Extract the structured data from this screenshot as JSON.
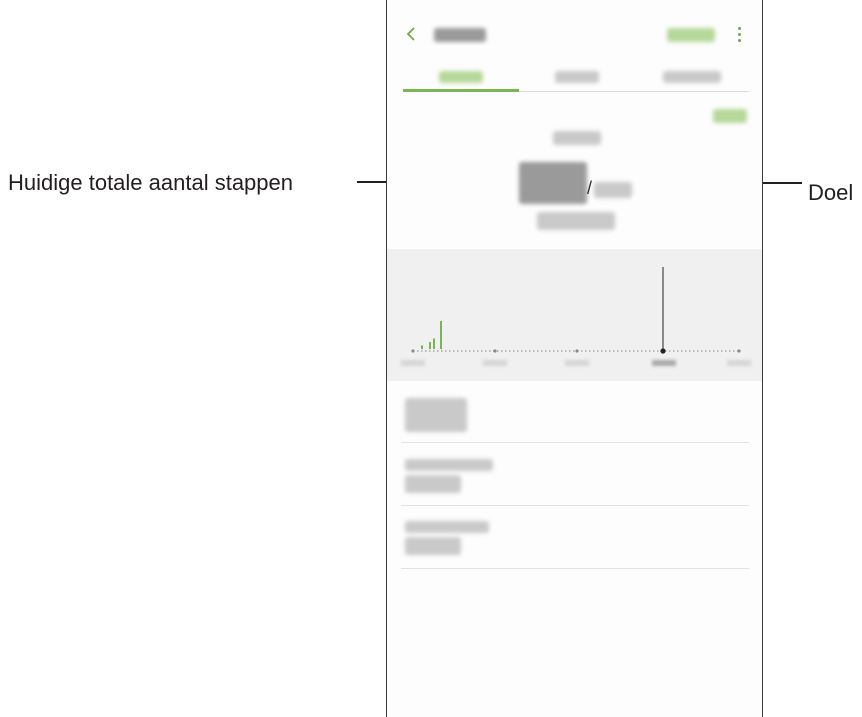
{
  "annotations": {
    "current_steps": "Huidige totale aantal stappen",
    "goal": "Doel"
  },
  "screen": {
    "goal_separator": "/",
    "colors": {
      "accent": "#79b653",
      "chart_background": "#f0f0f0",
      "bar_color": "#79b653",
      "marker_color": "#222222"
    },
    "icons": {
      "back": "chevron-left-icon",
      "more": "more-vertical-icon"
    },
    "tabs": [
      {
        "selected": true
      },
      {
        "selected": false
      },
      {
        "selected": false
      }
    ],
    "list_items": 3
  },
  "chart_data": {
    "type": "bar",
    "note_visibility": "labels blurred",
    "values": [
      1,
      2,
      3,
      8
    ],
    "series": [
      {
        "values": [
          1,
          2,
          3,
          8
        ]
      }
    ],
    "grid": false
  }
}
